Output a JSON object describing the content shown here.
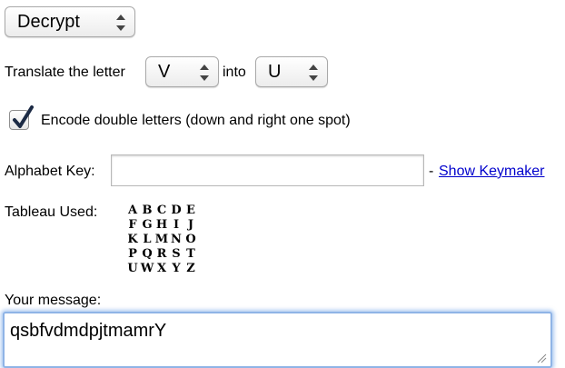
{
  "mode_select": {
    "value": "Decrypt"
  },
  "translate": {
    "prefix": "Translate the letter",
    "from_letter": "V",
    "middle": "into",
    "to_letter": "U"
  },
  "double_letters": {
    "checked": true,
    "label": "Encode double letters (down and right one spot)"
  },
  "alphabet_key": {
    "label": "Alphabet Key:",
    "value": "",
    "separator": "-",
    "link_label": "Show Keymaker"
  },
  "tableau": {
    "label": "Tableau Used:",
    "rows": [
      [
        "A",
        "B",
        "C",
        "D",
        "E"
      ],
      [
        "F",
        "G",
        "H",
        "I",
        "J"
      ],
      [
        "K",
        "L",
        "M",
        "N",
        "O"
      ],
      [
        "P",
        "Q",
        "R",
        "S",
        "T"
      ],
      [
        "U",
        "W",
        "X",
        "Y",
        "Z"
      ]
    ]
  },
  "message": {
    "label": "Your message:",
    "value": "qsbfvdmdpjtmamrY"
  },
  "icons": {
    "select_arrows": "up-down-chevrons-icon",
    "checkmark": "checkmark-icon",
    "resize": "resize-grip-icon"
  },
  "colors": {
    "link": "#0000cc",
    "focus_ring": "#8fb4e6",
    "checkmark": "#1b2a44"
  }
}
